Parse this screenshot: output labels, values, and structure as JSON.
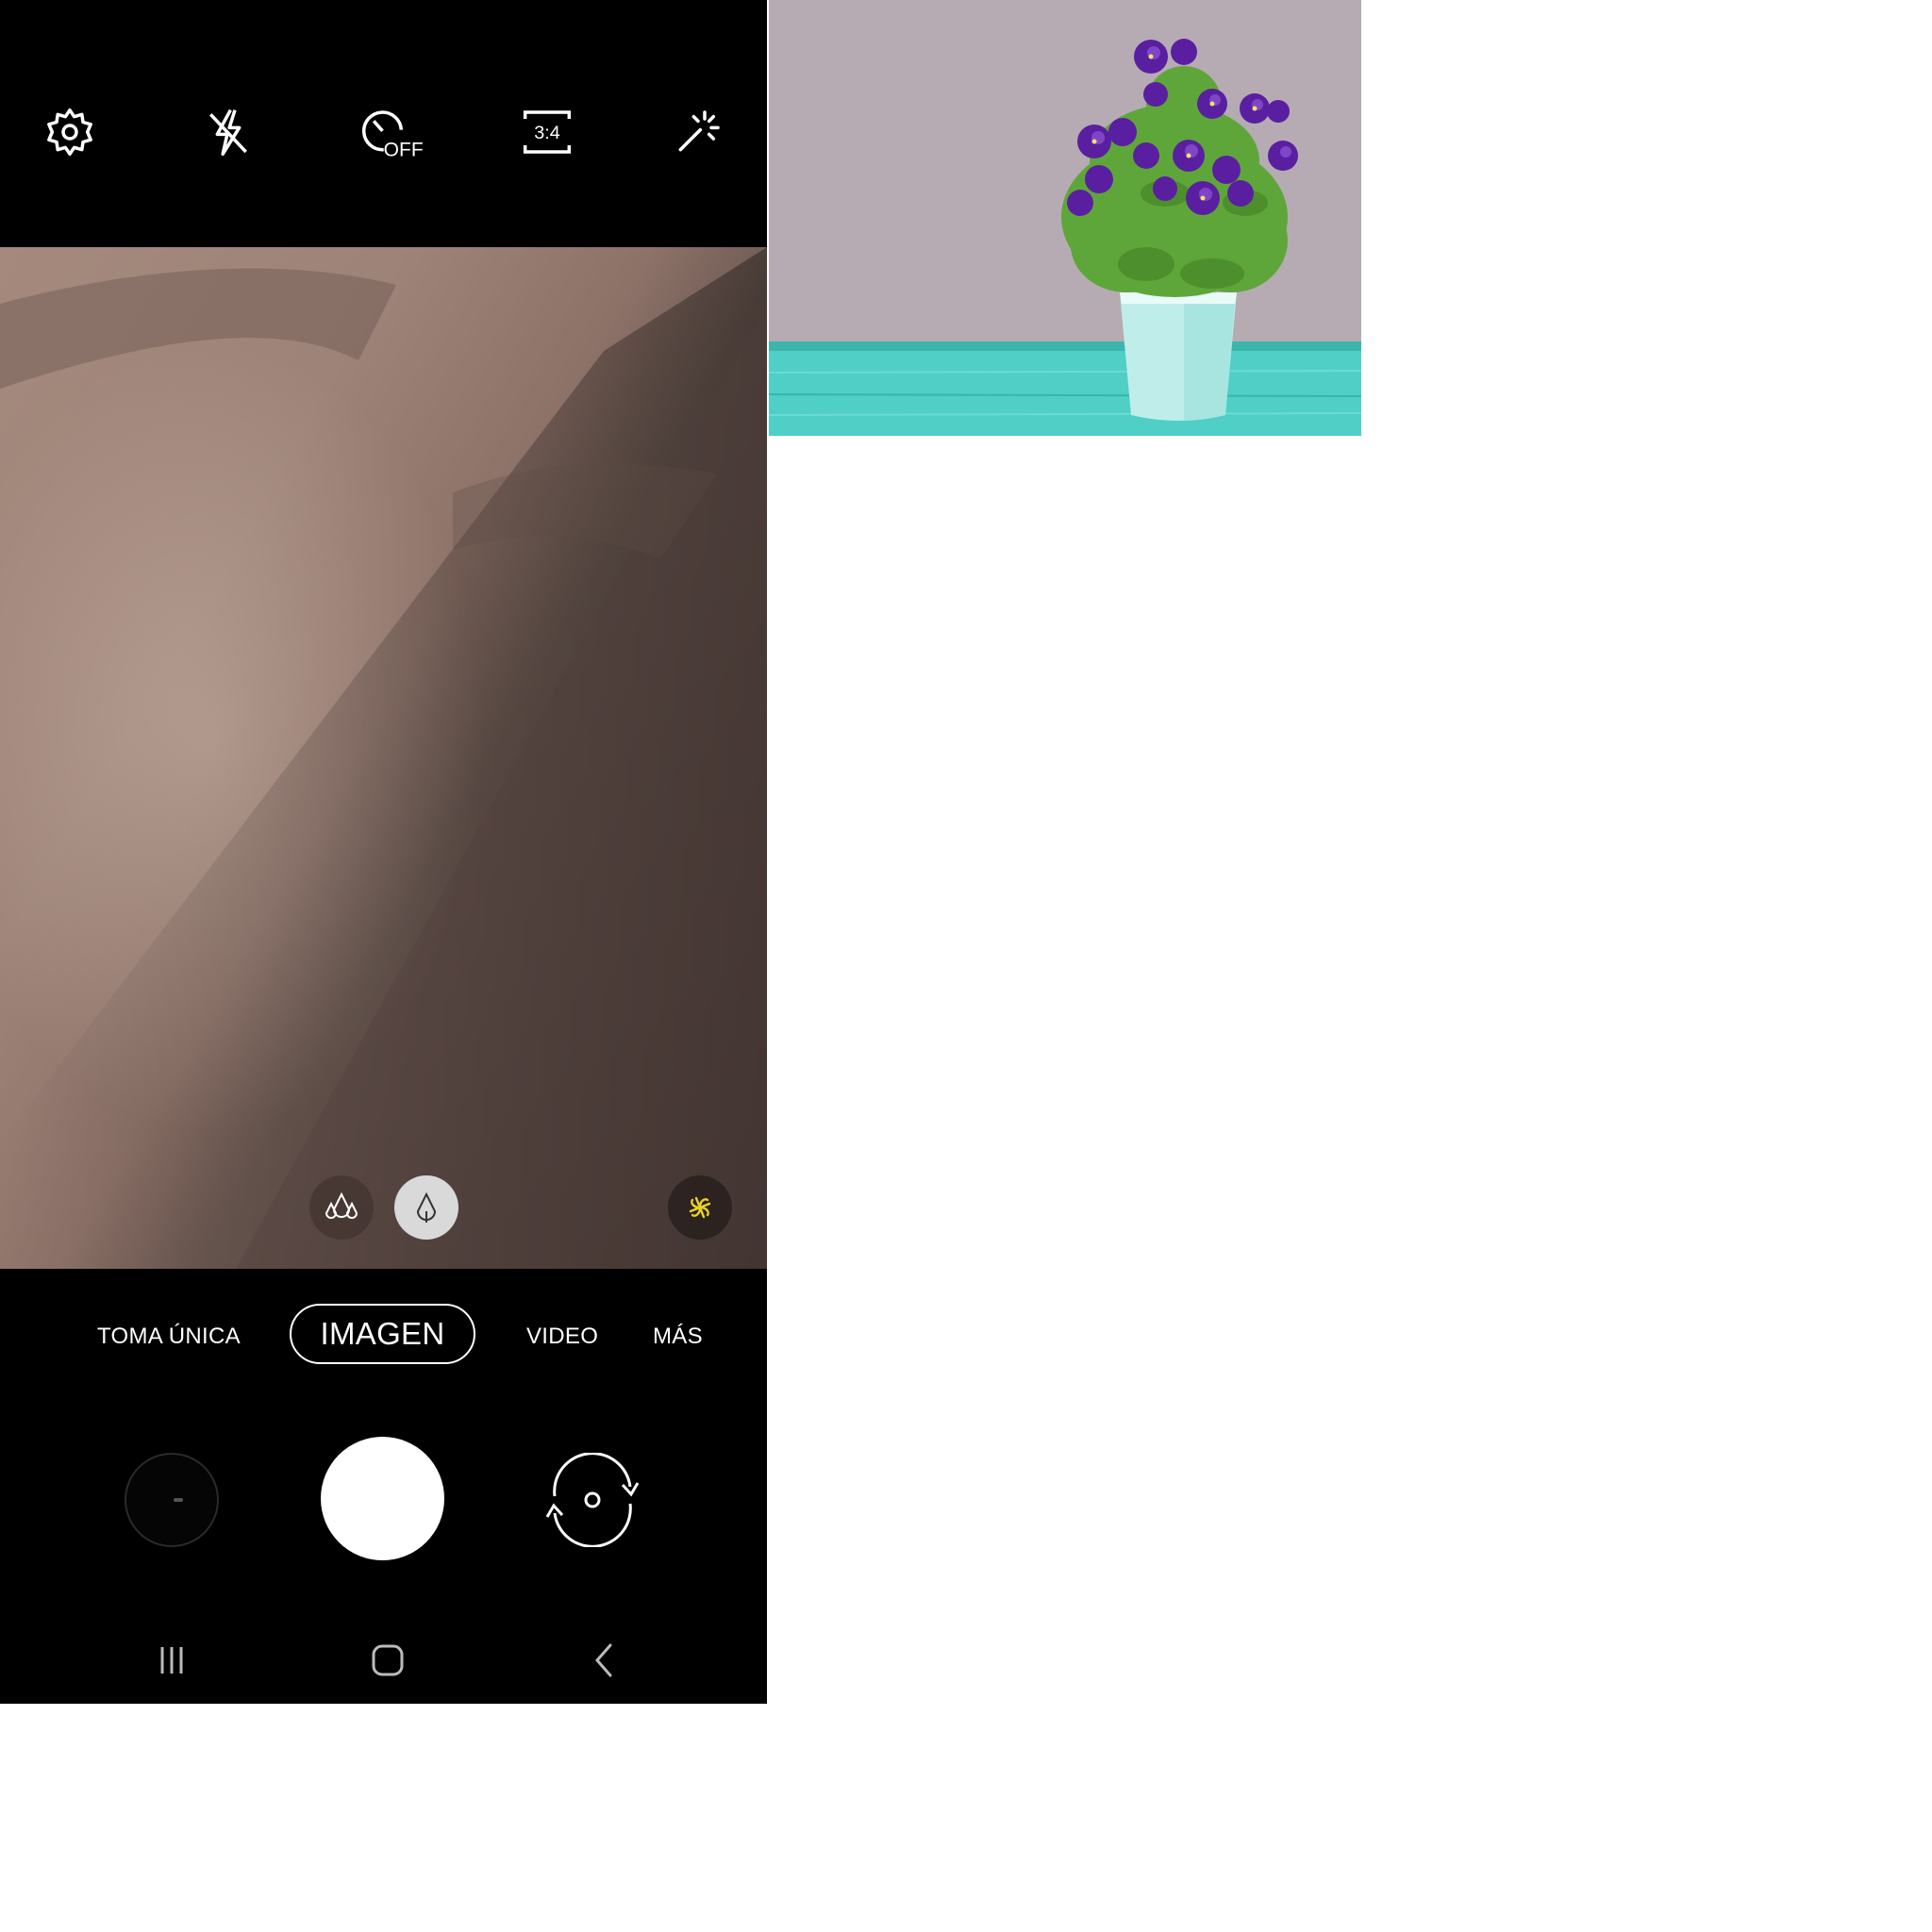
{
  "camera": {
    "top_bar": {
      "icons": [
        "settings-icon",
        "flash-off-icon",
        "timer-off-icon",
        "aspect-ratio-icon",
        "magic-effects-icon"
      ],
      "timer_label": "OFF",
      "ratio_label": "3:4"
    },
    "viewfinder": {
      "filter_buttons": [
        "filter-landscape-icon",
        "filter-drop-icon"
      ],
      "scene_optimizer": "scene-optimizer-icon",
      "scene_color": "#e6d228"
    },
    "modes": {
      "single_take": "TOMA ÚNICA",
      "photo": "IMAGEN",
      "video": "VIDEO",
      "more": "MÁS",
      "active": "IMAGEN"
    },
    "controls": [
      "gallery-thumbnail",
      "shutter-button",
      "switch-camera-button"
    ],
    "nav": [
      "recent-apps-icon",
      "home-icon",
      "back-icon"
    ]
  },
  "photo": {
    "subject": "potted-violets"
  }
}
